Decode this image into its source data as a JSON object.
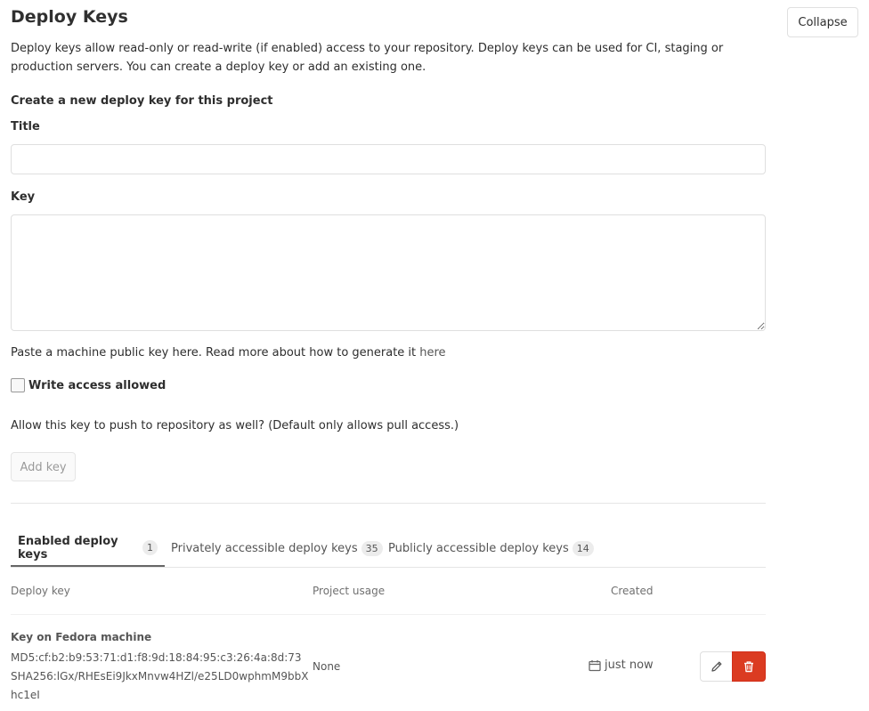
{
  "section": {
    "title": "Deploy Keys",
    "collapse_label": "Collapse",
    "description": "Deploy keys allow read-only or read-write (if enabled) access to your repository. Deploy keys can be used for CI, staging or production servers. You can create a deploy key or add an existing one."
  },
  "form": {
    "subheading": "Create a new deploy key for this project",
    "title_label": "Title",
    "title_value": "",
    "key_label": "Key",
    "key_value": "",
    "help_text": "Paste a machine public key here. Read more about how to generate it ",
    "help_link": "here",
    "write_access_label": "Write access allowed",
    "write_access_checked": false,
    "allow_text": "Allow this key to push to repository as well? (Default only allows pull access.)",
    "add_key_label": "Add key"
  },
  "tabs": [
    {
      "label": "Enabled deploy keys",
      "count": "1",
      "active": true
    },
    {
      "label": "Privately accessible deploy keys",
      "count": "35",
      "active": false
    },
    {
      "label": "Publicly accessible deploy keys",
      "count": "14",
      "active": false
    }
  ],
  "table": {
    "headers": {
      "deploy_key": "Deploy key",
      "project_usage": "Project usage",
      "created": "Created"
    },
    "rows": [
      {
        "title": "Key on Fedora machine",
        "md5": "MD5:cf:b2:b9:53:71:d1:f8:9d:18:84:95:c3:26:4a:8d:73",
        "sha256": "SHA256:lGx/RHEsEi9JkxMnvw4HZl/e25LD0wphmM9bbXhc1eI",
        "usage": "None",
        "created": "just now"
      }
    ]
  },
  "icons": {
    "calendar": "calendar-icon",
    "edit": "pencil-icon",
    "delete": "trash-icon"
  },
  "colors": {
    "delete": "#db3b21",
    "text": "#2e2e2e",
    "muted": "#707070",
    "border": "#dfdfdf"
  }
}
